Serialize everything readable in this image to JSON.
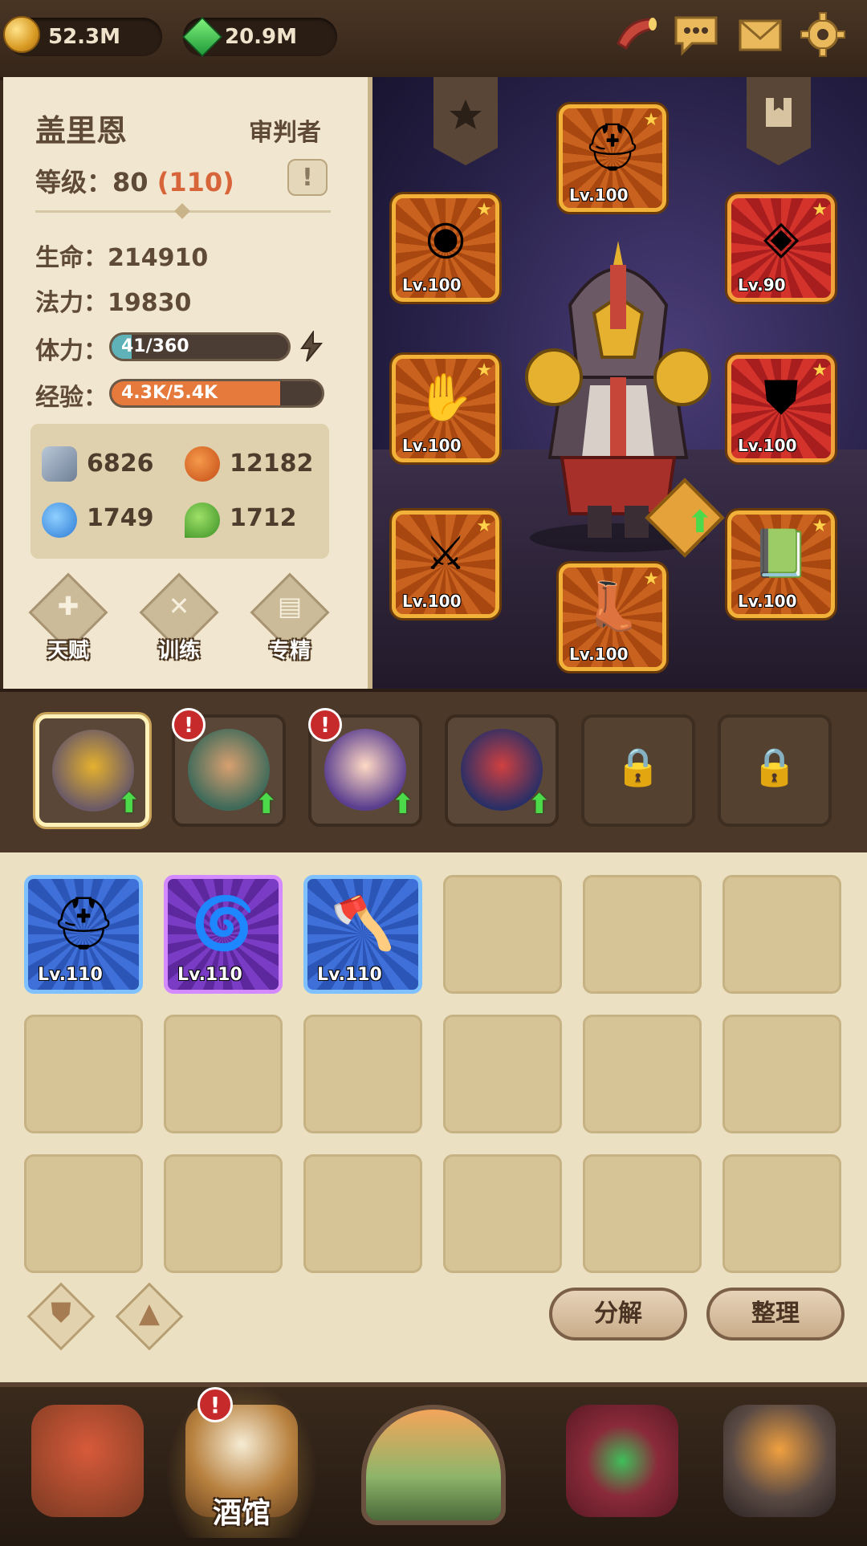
{
  "currencies": {
    "gold": "52.3M",
    "gems": "20.9M"
  },
  "top_icons": [
    {
      "name": "horn-icon"
    },
    {
      "name": "chat-icon"
    },
    {
      "name": "mail-icon"
    },
    {
      "name": "settings-icon"
    }
  ],
  "hero": {
    "name": "盖里恩",
    "class": "审判者",
    "level_label": "等级：",
    "level": "80",
    "level_cap": "(110)",
    "hp_label": "生命：",
    "hp": "214910",
    "mp_label": "法力：",
    "mp": "19830",
    "stamina_label": "体力：",
    "stamina_text": "41/360",
    "stamina_fraction": 0.114,
    "exp_label": "经验：",
    "exp_text": "4.3K/5.4K",
    "exp_fraction": 0.8,
    "attack": "6826",
    "fire": "12182",
    "frost": "1749",
    "nature": "1712"
  },
  "actions": [
    {
      "label": "天赋"
    },
    {
      "label": "训练"
    },
    {
      "label": "专精"
    }
  ],
  "equipment": [
    {
      "slot": "helmet",
      "level": "Lv.100"
    },
    {
      "slot": "amulet",
      "level": "Lv.100"
    },
    {
      "slot": "ring",
      "level": "Lv.90"
    },
    {
      "slot": "gloves",
      "level": "Lv.100"
    },
    {
      "slot": "armor",
      "level": "Lv.100"
    },
    {
      "slot": "weapon",
      "level": "Lv.100"
    },
    {
      "slot": "boots",
      "level": "Lv.100"
    },
    {
      "slot": "tome",
      "level": "Lv.100"
    }
  ],
  "roster": {
    "alert": "!"
  },
  "inventory": [
    {
      "item": "helm",
      "level": "Lv.110"
    },
    {
      "item": "arm-bracer",
      "level": "Lv.110"
    },
    {
      "item": "axe",
      "level": "Lv.110"
    }
  ],
  "inventory_buttons": {
    "decompose": "分解",
    "sort": "整理"
  },
  "nav": [
    {
      "id": "home"
    },
    {
      "id": "tavern",
      "label": "酒馆",
      "alert": "!"
    },
    {
      "id": "adventure"
    },
    {
      "id": "treasury"
    },
    {
      "id": "forge"
    }
  ],
  "colors": {
    "accent_red": "#d8643a",
    "stamina_fill": "#5fb3b8",
    "exp_fill": "#e6793c"
  }
}
